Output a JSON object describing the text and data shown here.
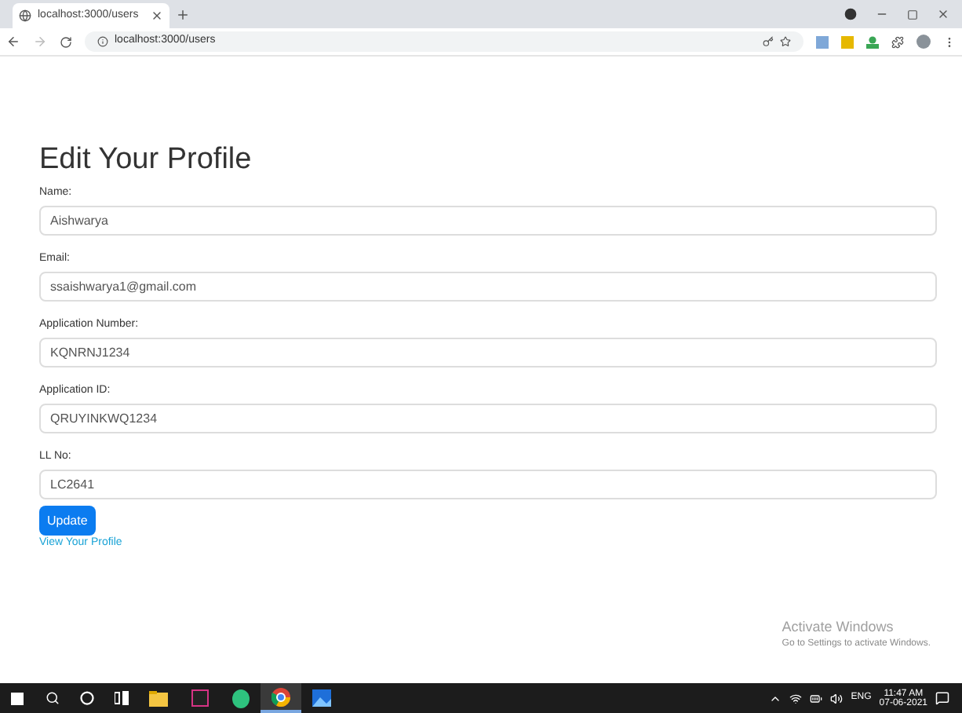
{
  "browser": {
    "tab_title": "localhost:3000/users",
    "address": "localhost:3000/users"
  },
  "form": {
    "title": "Edit Your Profile",
    "fields": [
      {
        "label": "Name:",
        "value": "Aishwarya"
      },
      {
        "label": "Email:",
        "value": "ssaishwarya1@gmail.com"
      },
      {
        "label": "Application Number:",
        "value": "KQNRNJ1234"
      },
      {
        "label": "Application ID:",
        "value": "QRUYINKWQ1234"
      },
      {
        "label": "LL No:",
        "value": "LC2641"
      }
    ],
    "button": "Update",
    "link": "View Your Profile"
  },
  "activation": {
    "title": "Activate Windows",
    "subtitle": "Go to Settings to activate Windows."
  },
  "taskbar": {
    "apps": [
      {
        "kind": "folder",
        "selected": false
      },
      {
        "kind": "terminal",
        "selected": false
      },
      {
        "kind": "green",
        "selected": false
      },
      {
        "kind": "browser",
        "selected": true
      },
      {
        "kind": "photos",
        "selected": false
      }
    ],
    "language": "ENG",
    "time": "11:47 AM",
    "date": "07-06-2021"
  }
}
